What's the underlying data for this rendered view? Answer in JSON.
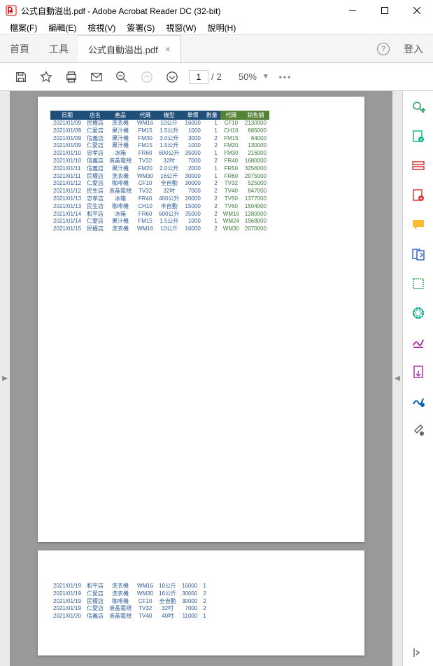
{
  "window": {
    "title": "公式自動溢出.pdf - Adobe Acrobat Reader DC (32-bit)"
  },
  "menu": {
    "file": "檔案(F)",
    "edit": "編輯(E)",
    "view": "檢視(V)",
    "sign": "簽署(S)",
    "window": "視窗(W)",
    "help": "說明(H)"
  },
  "tabs": {
    "home": "首頁",
    "tools": "工具",
    "active": "公式自動溢出.pdf",
    "login": "登入"
  },
  "toolbar": {
    "current_page": "1",
    "page_sep": "/",
    "total_pages": "2",
    "zoom": "50%"
  },
  "table1": {
    "headers": [
      "日期",
      "店名",
      "產品",
      "代碼",
      "機型",
      "單價",
      "數量",
      "代碼",
      "銷售額"
    ],
    "rows": [
      [
        "2021/01/09",
        "民權店",
        "洗衣機",
        "WM16",
        "10公斤",
        "16000",
        "1",
        "CF10",
        "2130000"
      ],
      [
        "2021/01/09",
        "仁愛店",
        "果汁機",
        "FM15",
        "1.5公升",
        "1000",
        "1",
        "CH10",
        "885000"
      ],
      [
        "2021/01/09",
        "信義店",
        "果汁機",
        "FM30",
        "3.0公升",
        "3000",
        "2",
        "FM15",
        "64000"
      ],
      [
        "2021/01/09",
        "仁愛店",
        "果汁機",
        "FM15",
        "1.5公升",
        "1000",
        "2",
        "FM20",
        "130000"
      ],
      [
        "2021/01/10",
        "忠孝店",
        "冰箱",
        "FR60",
        "600公升",
        "35000",
        "1",
        "FM30",
        "216000"
      ],
      [
        "2021/01/10",
        "信義店",
        "液晶電視",
        "TV32",
        "32吋",
        "7000",
        "2",
        "FR40",
        "1680000"
      ],
      [
        "2021/01/11",
        "信義店",
        "果汁機",
        "FM20",
        "2.0公升",
        "2000",
        "1",
        "FR50",
        "3256000"
      ],
      [
        "2021/01/11",
        "民權店",
        "洗衣機",
        "WM30",
        "16公斤",
        "30000",
        "1",
        "FR60",
        "2975000"
      ],
      [
        "2021/01/12",
        "仁愛店",
        "咖啡機",
        "CF10",
        "全自動",
        "30000",
        "2",
        "TV32",
        "525000"
      ],
      [
        "2021/01/12",
        "民生店",
        "液晶電視",
        "TV32",
        "32吋",
        "7000",
        "2",
        "TV40",
        "847000"
      ],
      [
        "2021/01/13",
        "忠孝店",
        "冰箱",
        "FR40",
        "400公升",
        "20000",
        "2",
        "TV50",
        "1377000"
      ],
      [
        "2021/01/13",
        "民生店",
        "咖啡機",
        "CH10",
        "半自動",
        "15000",
        "2",
        "TV60",
        "1504000"
      ],
      [
        "2021/01/14",
        "和平店",
        "冰箱",
        "FR60",
        "600公升",
        "35000",
        "2",
        "WM16",
        "1280000"
      ],
      [
        "2021/01/14",
        "仁愛店",
        "果汁機",
        "FM15",
        "1.5公升",
        "1000",
        "1",
        "WM24",
        "1968000"
      ],
      [
        "2021/01/15",
        "民權店",
        "洗衣機",
        "WM16",
        "10公斤",
        "16000",
        "2",
        "WM30",
        "2070000"
      ]
    ]
  },
  "table2": {
    "rows": [
      [
        "2021/01/19",
        "和平店",
        "洗衣機",
        "WM16",
        "10公斤",
        "16000",
        "1"
      ],
      [
        "2021/01/19",
        "仁愛店",
        "洗衣機",
        "WM30",
        "16公斤",
        "30000",
        "2"
      ],
      [
        "2021/01/19",
        "民權店",
        "咖啡機",
        "CF10",
        "全自動",
        "30000",
        "2"
      ],
      [
        "2021/01/19",
        "仁愛店",
        "液晶電視",
        "TV32",
        "32吋",
        "7000",
        "2"
      ],
      [
        "2021/01/20",
        "信義店",
        "液晶電視",
        "TV40",
        "40吋",
        "11000",
        "1"
      ]
    ]
  }
}
